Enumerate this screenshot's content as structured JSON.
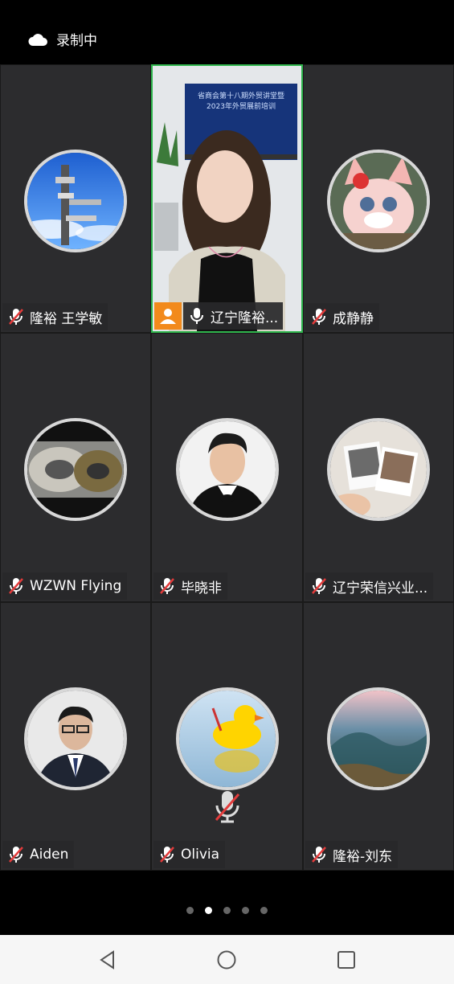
{
  "status": {
    "recording_label": "录制中"
  },
  "participants": [
    {
      "name": "隆裕 王学敏",
      "muted": true
    },
    {
      "name": "辽宁隆裕...",
      "muted": false,
      "host": true,
      "video": true
    },
    {
      "name": "成静静",
      "muted": true
    },
    {
      "name": "WZWN Flying",
      "muted": true
    },
    {
      "name": "毕晓非",
      "muted": true
    },
    {
      "name": "辽宁荣信兴业...",
      "muted": true
    },
    {
      "name": "Aiden",
      "muted": true
    },
    {
      "name": "Olivia",
      "muted": true
    },
    {
      "name": "隆裕-刘东",
      "muted": true
    }
  ],
  "video_slide": {
    "line1": "省商会第十八期外贸讲堂暨",
    "line2": "2023年外贸展前培训"
  },
  "pager": {
    "total": 5,
    "current": 2
  },
  "colors": {
    "accent_green": "#2fb64d",
    "host_orange": "#f28a1c",
    "mute_red": "#e33b3b"
  }
}
